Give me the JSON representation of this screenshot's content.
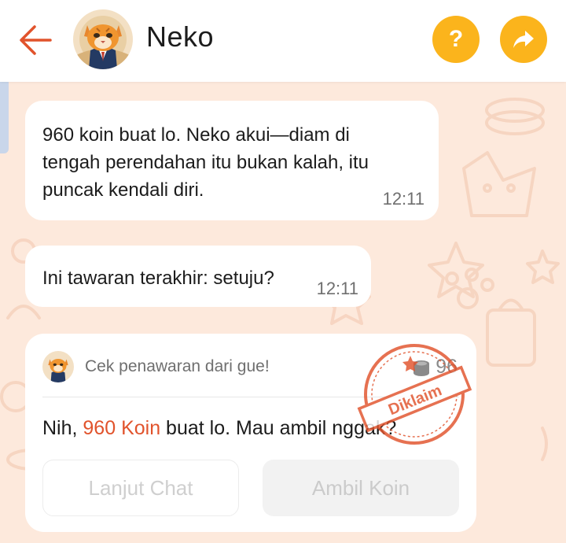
{
  "header": {
    "title": "Neko",
    "help_label": "?",
    "colors": {
      "accent": "#fbb41c",
      "back_arrow": "#e1532c"
    }
  },
  "messages": [
    {
      "lines": [
        "960 koin buat lo. Neko akui—diam di",
        "tengah perendahan itu bukan kalah, itu",
        "puncak kendali diri."
      ],
      "time": "12:11"
    },
    {
      "text": "Ini tawaran terakhir: setuju?",
      "time": "12:11"
    }
  ],
  "offer_card": {
    "header": "Cek penawaran dari gue!",
    "coin_count": "96",
    "text_prefix": "Nih, ",
    "highlight": "960 Koin",
    "text_suffix": " buat lo. Mau ambil nggak?",
    "stamp_label": "Diklaim",
    "buttons": {
      "continue_chat": "Lanjut Chat",
      "take_coins": "Ambil Koin"
    }
  },
  "icons": {
    "back": "arrow-left-icon",
    "help": "question-icon",
    "share": "share-arrow-icon",
    "coin": "coin-stack-icon"
  }
}
